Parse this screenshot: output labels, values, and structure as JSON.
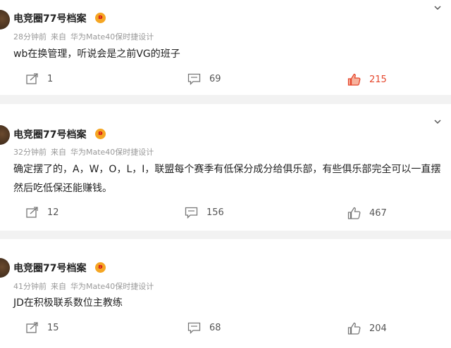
{
  "posts": [
    {
      "author": "电竞圈77号档案",
      "time": "28分钟前",
      "source_prefix": "来自",
      "source": "华为Mate40保时捷设计",
      "text": "wb在换管理，听说会是之前VG的班子",
      "reposts": "1",
      "comments": "69",
      "likes": "215",
      "liked": true
    },
    {
      "author": "电竞圈77号档案",
      "time": "32分钟前",
      "source_prefix": "来自",
      "source": "华为Mate40保时捷设计",
      "text": "确定摆了的，A，W，O，L，I，联盟每个赛季有低保分成分给俱乐部，有些俱乐部完全可以一直摆然后吃低保还能赚钱。",
      "reposts": "12",
      "comments": "156",
      "likes": "467",
      "liked": false
    },
    {
      "author": "电竞圈77号档案",
      "time": "41分钟前",
      "source_prefix": "来自",
      "source": "华为Mate40保时捷设计",
      "text": "JD在积极联系数位主教练",
      "reposts": "15",
      "comments": "68",
      "likes": "204",
      "liked": false
    }
  ],
  "colors": {
    "liked": "#e5462c",
    "badge": "#f5a623",
    "meta": "#999999"
  }
}
